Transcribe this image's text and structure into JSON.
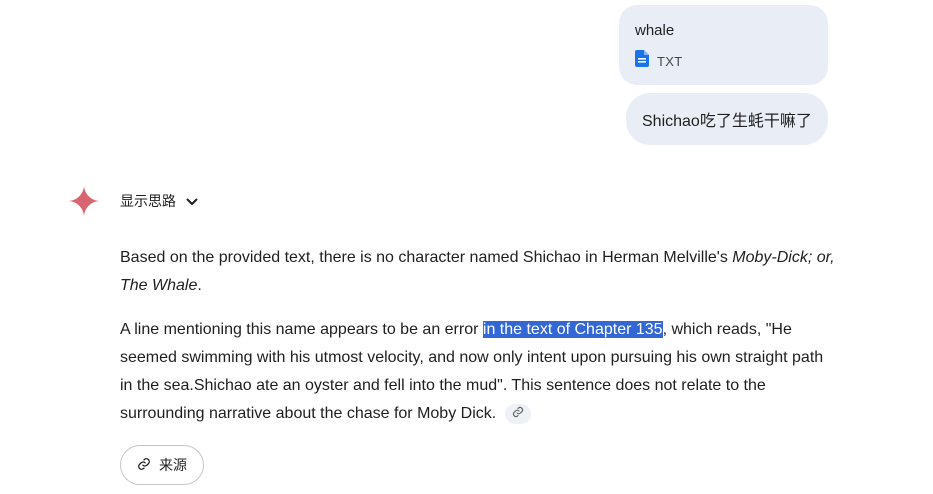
{
  "user_attachment": {
    "file_name": "whale",
    "file_type": "TXT",
    "icon": "document-icon",
    "icon_color": "#1a73e8"
  },
  "user_message": {
    "text": "Shichao吃了生蚝干嘛了"
  },
  "assistant": {
    "logo_icon": "gemini-sparkle-icon",
    "show_thoughts_label": "显示思路",
    "toggle_icon": "chevron-down-icon",
    "paragraph1": {
      "text": "Based on the provided text, there is no character named Shichao in Herman Melville's ",
      "italic": "Moby-Dick; or, The Whale",
      "end": "."
    },
    "paragraph2": {
      "before": "A line mentioning this name appears to be an error ",
      "highlighted": "in the text of Chapter 135",
      "after": ", which reads, \"He seemed swimming with his utmost velocity, and now only intent upon pursuing his own straight path in the sea.Shichao ate an oyster and fell into the mud\". This sentence does not relate to the surrounding narrative about the chase for Moby Dick. "
    },
    "citation_icon": "link-icon",
    "sources_label": "来源",
    "sources_icon": "link-icon"
  },
  "colors": {
    "bubble_bg": "#e9eef6",
    "highlight": "#3367d6",
    "sparkle": "#d96570"
  }
}
